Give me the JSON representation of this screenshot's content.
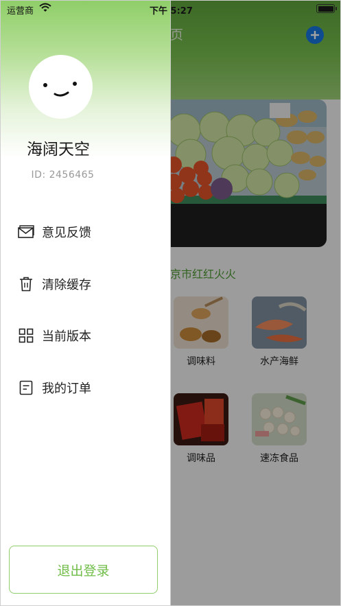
{
  "status_bar": {
    "carrier": "运营商",
    "time": "下午 5:27"
  },
  "background_page": {
    "title_fragment": "页",
    "store_name": "京市红红火火",
    "categories": [
      {
        "label": "调味料"
      },
      {
        "label": "水产海鲜"
      },
      {
        "label": "调味品"
      },
      {
        "label": "速冻食品"
      }
    ]
  },
  "drawer": {
    "user_name": "海阔天空",
    "user_id": "ID: 2456465",
    "menu": [
      {
        "label": "意见反馈",
        "icon": "mail-icon"
      },
      {
        "label": "清除缓存",
        "icon": "trash-icon"
      },
      {
        "label": "当前版本",
        "icon": "grid-icon"
      },
      {
        "label": "我的订单",
        "icon": "document-icon"
      }
    ],
    "logout_label": "退出登录"
  },
  "colors": {
    "accent_green": "#6fbd46",
    "header_green": "#5fa73d",
    "plus_blue": "#1877e0"
  }
}
